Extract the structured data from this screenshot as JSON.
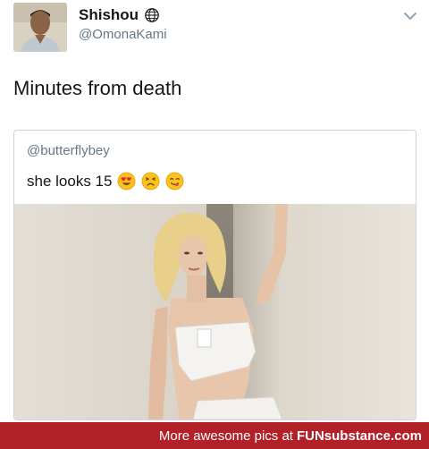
{
  "tweet": {
    "display_name": "Shishou",
    "handle": "@OmonaKami",
    "text": "Minutes from death"
  },
  "quoted_tweet": {
    "handle": "@butterflybey",
    "text": "she looks 15",
    "emojis": [
      "heart-eyes-emoji",
      "persevering-face-emoji",
      "yum-face-emoji"
    ]
  },
  "icons": {
    "verified_globe": "globe-icon",
    "menu": "chevron-down-icon"
  },
  "footer": {
    "text": "More awesome pics at",
    "brand": "FUNsubstance.com"
  },
  "colors": {
    "text": "#14171a",
    "muted": "#657786",
    "border": "#ccd6dd",
    "footer_bg": "#b22028"
  }
}
